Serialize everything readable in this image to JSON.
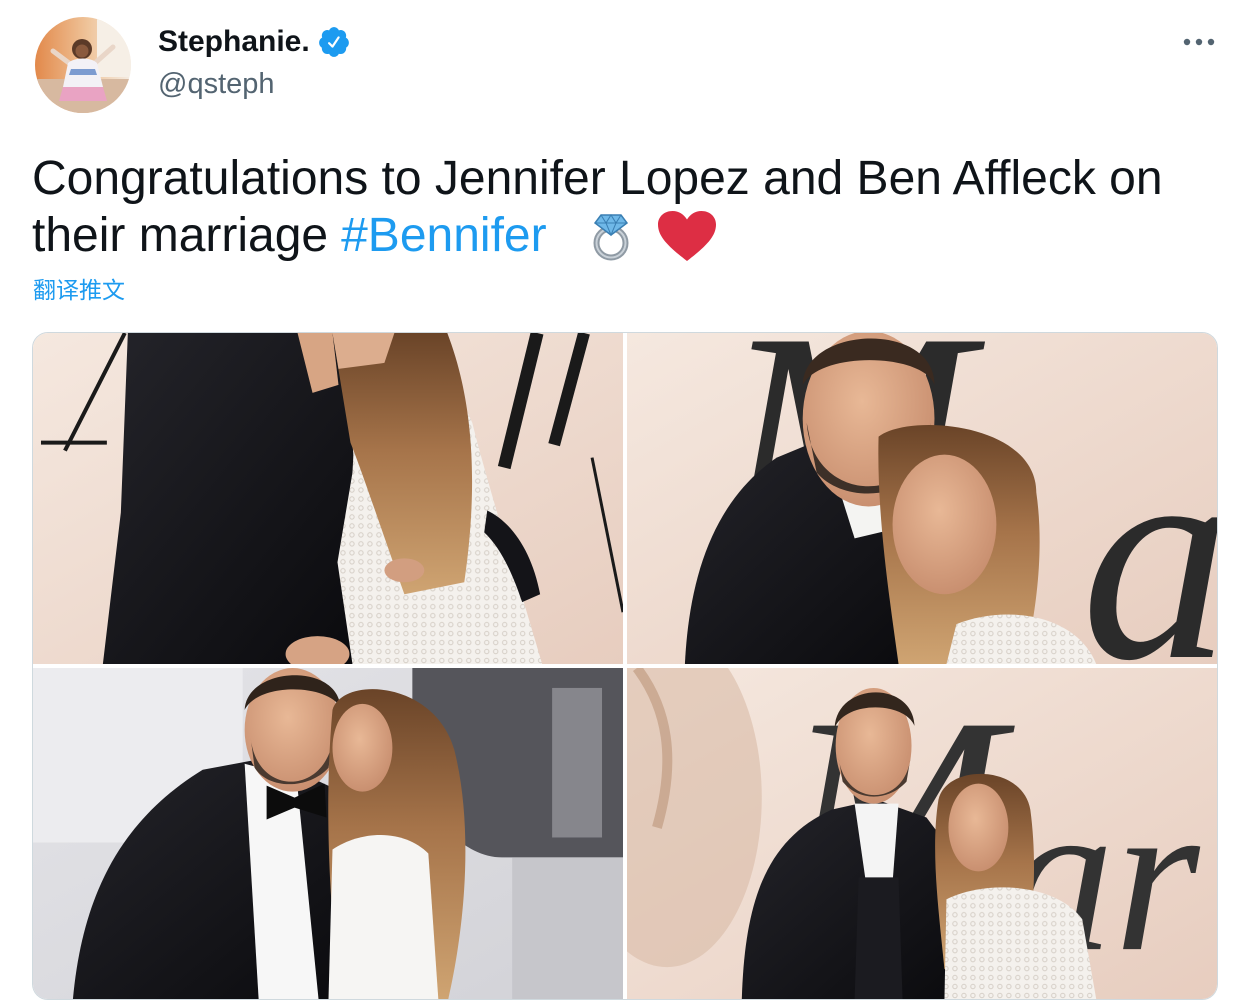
{
  "tweet": {
    "author": {
      "display_name": "Stephanie.",
      "handle": "@qsteph",
      "avatar_icon": "profile-avatar",
      "verified_icon": "verified-badge-icon"
    },
    "more_icon": "more-horizontal-icon",
    "text": {
      "line1": "Congratulations to Jennifer Lopez and Ben Affleck on",
      "line2": "their marriage",
      "hashtag": "#Bennifer",
      "emojis": [
        "ring-emoji",
        "red-heart-emoji"
      ]
    },
    "translate_link": "翻译推文",
    "media": {
      "photos": [
        {
          "backdrop_letters": []
        },
        {
          "backdrop_letters": [
            "M",
            "a"
          ]
        },
        {
          "backdrop_letters": []
        },
        {
          "backdrop_letters": [
            "M",
            "ar"
          ]
        }
      ]
    }
  },
  "colors": {
    "text": "#0f1419",
    "secondary": "#536471",
    "accent": "#1d9bf0",
    "heart": "#dd2e44"
  }
}
